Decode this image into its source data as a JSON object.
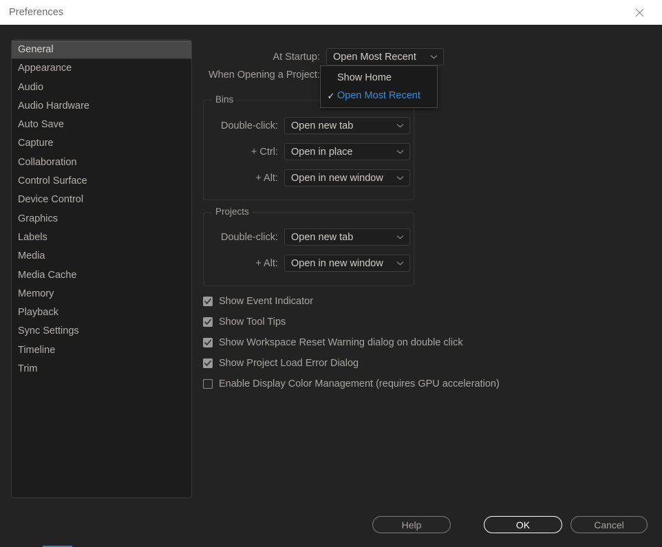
{
  "window": {
    "title": "Preferences",
    "close_icon": "close-icon"
  },
  "sidebar": {
    "items": [
      {
        "label": "General",
        "selected": true
      },
      {
        "label": "Appearance",
        "selected": false
      },
      {
        "label": "Audio",
        "selected": false
      },
      {
        "label": "Audio Hardware",
        "selected": false
      },
      {
        "label": "Auto Save",
        "selected": false
      },
      {
        "label": "Capture",
        "selected": false
      },
      {
        "label": "Collaboration",
        "selected": false
      },
      {
        "label": "Control Surface",
        "selected": false
      },
      {
        "label": "Device Control",
        "selected": false
      },
      {
        "label": "Graphics",
        "selected": false
      },
      {
        "label": "Labels",
        "selected": false
      },
      {
        "label": "Media",
        "selected": false
      },
      {
        "label": "Media Cache",
        "selected": false
      },
      {
        "label": "Memory",
        "selected": false
      },
      {
        "label": "Playback",
        "selected": false
      },
      {
        "label": "Sync Settings",
        "selected": false
      },
      {
        "label": "Timeline",
        "selected": false
      },
      {
        "label": "Trim",
        "selected": false
      }
    ]
  },
  "general": {
    "at_startup": {
      "label": "At Startup:",
      "value": "Open Most Recent",
      "expanded": true,
      "options": [
        {
          "label": "Show Home",
          "checked": false,
          "highlighted": false
        },
        {
          "label": "Open Most Recent",
          "checked": true,
          "highlighted": true
        }
      ],
      "check_glyph": "✓"
    },
    "when_opening_label": "When Opening a Project:",
    "bins": {
      "title": "Bins",
      "rows": [
        {
          "label": "Double-click:",
          "value": "Open new tab"
        },
        {
          "label": "+ Ctrl:",
          "value": "Open in place"
        },
        {
          "label": "+ Alt:",
          "value": "Open in new window"
        }
      ]
    },
    "projects": {
      "title": "Projects",
      "rows": [
        {
          "label": "Double-click:",
          "value": "Open new tab"
        },
        {
          "label": "+ Alt:",
          "value": "Open in new window"
        }
      ]
    },
    "checkboxes": [
      {
        "label": "Show Event Indicator",
        "checked": true
      },
      {
        "label": "Show Tool Tips",
        "checked": true
      },
      {
        "label": "Show Workspace Reset Warning dialog on double click",
        "checked": true
      },
      {
        "label": "Show Project Load Error Dialog",
        "checked": true
      },
      {
        "label": "Enable Display Color Management (requires GPU acceleration)",
        "checked": false
      }
    ]
  },
  "footer": {
    "help": "Help",
    "ok": "OK",
    "cancel": "Cancel"
  },
  "colors": {
    "accent_blue": "#2f8fe0",
    "dialog_bg": "#232323",
    "titlebar_bg": "#ffffff",
    "selected_item_bg": "#484848"
  }
}
